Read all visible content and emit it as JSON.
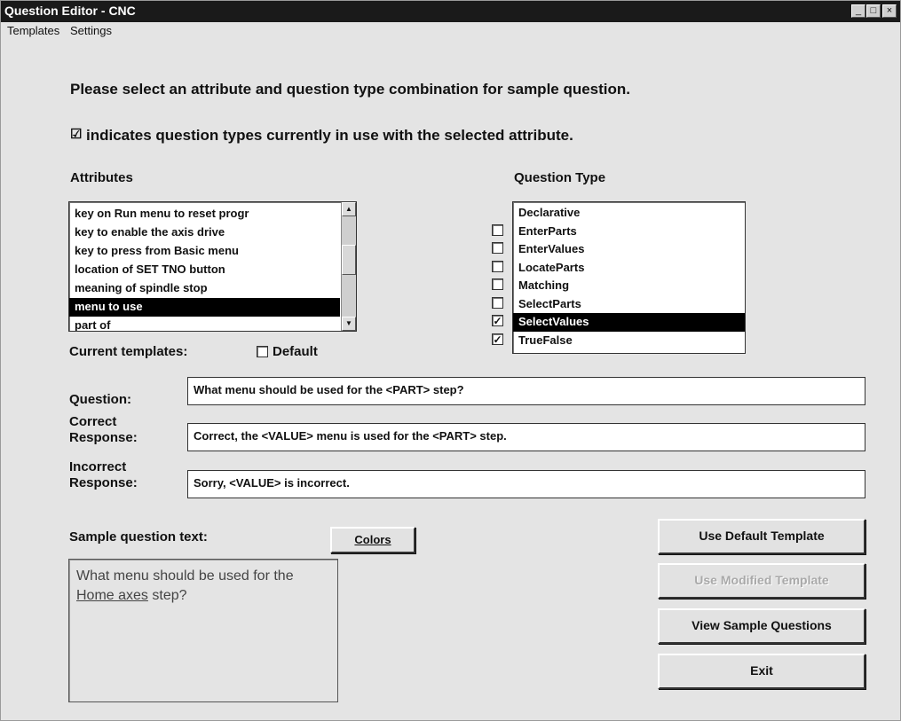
{
  "window": {
    "title": "Question Editor - CNC",
    "controls": [
      "_",
      "□",
      "×"
    ]
  },
  "menu": [
    "Templates",
    "Settings"
  ],
  "instructions": {
    "line1": "Please select an attribute and question type combination for sample question.",
    "line2": "indicates question types currently in use with the selected attribute."
  },
  "attributes": {
    "label": "Attributes",
    "items": [
      {
        "label": "key on Run menu to reset progr",
        "selected": false
      },
      {
        "label": "key to enable the axis drive",
        "selected": false
      },
      {
        "label": "key to press from Basic menu",
        "selected": false
      },
      {
        "label": "location of SET TNO button",
        "selected": false
      },
      {
        "label": "meaning of spindle stop",
        "selected": false
      },
      {
        "label": "menu to use",
        "selected": true
      },
      {
        "label": "part of",
        "selected": false
      }
    ]
  },
  "question_type": {
    "label": "Question Type",
    "items": [
      {
        "label": "Declarative",
        "checked": false,
        "selected": false
      },
      {
        "label": "EnterParts",
        "checked": false,
        "selected": false
      },
      {
        "label": "EnterValues",
        "checked": false,
        "selected": false
      },
      {
        "label": "LocateParts",
        "checked": false,
        "selected": false
      },
      {
        "label": "Matching",
        "checked": false,
        "selected": false
      },
      {
        "label": "SelectParts",
        "checked": false,
        "selected": false
      },
      {
        "label": "SelectValues",
        "checked": true,
        "selected": true
      },
      {
        "label": "TrueFalse",
        "checked": true,
        "selected": false
      }
    ]
  },
  "templates": {
    "label": "Current templates:",
    "default_label": "Default",
    "default_checked": false
  },
  "fields": {
    "question_label": "Question:",
    "question_value": "What menu should be used for the <PART> step?",
    "correct_label_1": "Correct",
    "correct_label_2": "Response:",
    "correct_value": "Correct, the <VALUE> menu is used for the <PART> step.",
    "incorrect_label_1": "Incorrect",
    "incorrect_label_2": "Response:",
    "incorrect_value": "Sorry, <VALUE> is incorrect."
  },
  "sample": {
    "label": "Sample question text:",
    "colors_button": "Colors",
    "text_before": "What menu should be used for the ",
    "link_text": "Home axes",
    "text_after": " step?"
  },
  "buttons": {
    "use_default": "Use Default Template",
    "use_modified": "Use Modified Template",
    "view_samples": "View Sample Questions",
    "exit": "Exit"
  }
}
